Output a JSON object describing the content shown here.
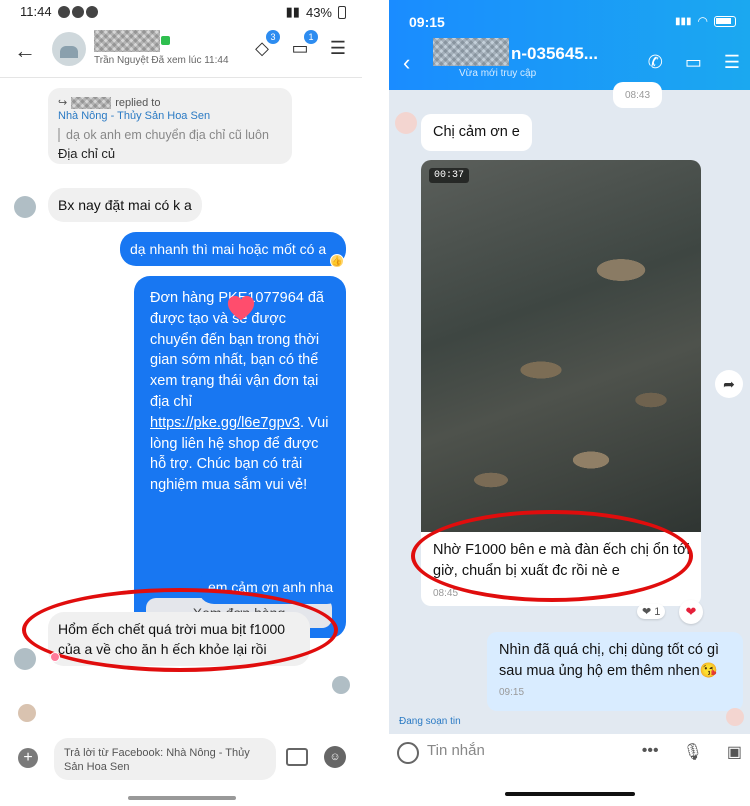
{
  "left": {
    "status": {
      "time": "11:44",
      "battery": "43%"
    },
    "header": {
      "subtitle": "Trần Nguyệt Đã xem lúc 11:44",
      "badge_a": "3",
      "badge_b": "1"
    },
    "reply": {
      "replied_to": "replied to",
      "source": "Nhà Nông - Thủy Sản Hoa Sen",
      "quote": "dạ ok anh em chuyển địa chỉ cũ luôn",
      "text": "Địa chỉ củ"
    },
    "messages": {
      "m1": "Bx nay đặt mai có k a",
      "m2": "dạ nhanh thì mai hoặc mốt có a",
      "order_pre": "Đơn hàng PKE107796",
      "order_mid": "4 đã được tạo và sẽ được chuyển đến bạn trong thời gian sớm nhất, bạn có thể xem trạng thái vận đơn tại địa chỉ ",
      "order_link": "https://pke.gg/l6e7gpv3",
      "order_post": ". Vui lòng liên hệ shop để được hỗ trợ. Chúc bạn có trải nghiệm mua sắm vui vẻ!",
      "order_button": "Xem đơn hàng",
      "m3": "em cảm ơn anh nha",
      "m4": "Hổm ếch chết quá trời mua bịt f1000 của a về cho ăn h ếch khỏe lại rồi"
    },
    "composer": {
      "placeholder": "Trả lời từ Facebook: Nhà Nông - Thủy Sản Hoa Sen"
    }
  },
  "right": {
    "status": {
      "time": "09:15"
    },
    "header": {
      "name": "n-035645...",
      "subtitle": "Vừa mới truy cập"
    },
    "top_time": "08:43",
    "messages": {
      "m1": "Chị cảm ơn e",
      "video_duration": "00:37",
      "caption": "Nhờ F1000 bên e mà đàn ếch chị ổn tới giờ, chuẩn bị xuất đc rồi nè e",
      "caption_time": "08:45",
      "reaction": "❤ 1",
      "m2": "Nhìn đã quá chị, chị dùng tốt có gì sau mua ủng hộ em thêm nhen😘",
      "m2_time": "09:15"
    },
    "typing": "Đang soạn tin",
    "composer": {
      "placeholder": "Tin nhắn"
    }
  }
}
